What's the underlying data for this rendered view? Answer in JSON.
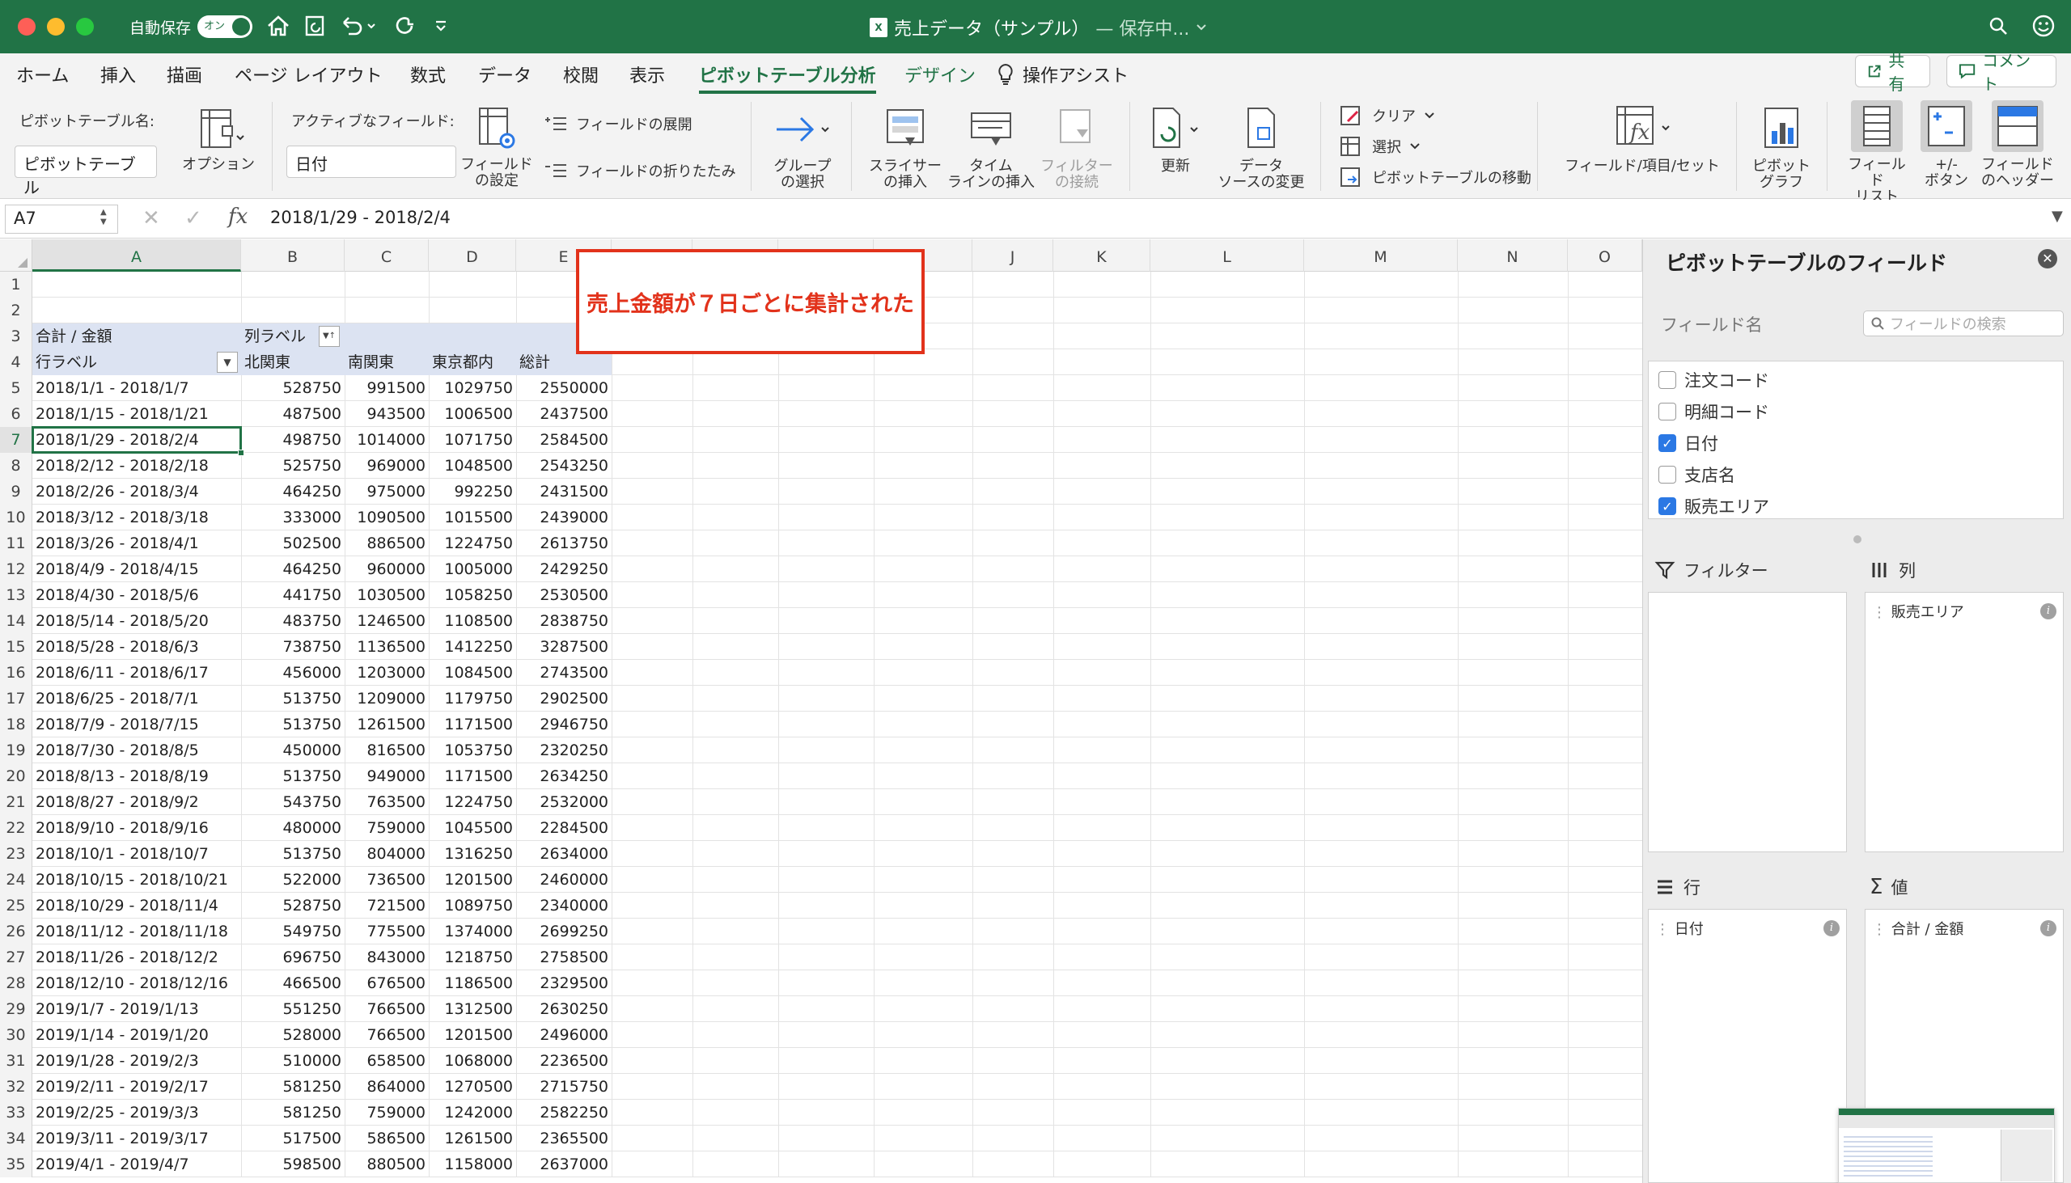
{
  "titlebar": {
    "autosave_label": "自動保存",
    "autosave_state": "オン",
    "doc_title": "売上データ（サンプル）",
    "doc_status": "— 保存中...",
    "app_icon_text": "X"
  },
  "ribbon_tabs": [
    "ホーム",
    "挿入",
    "描画",
    "ページ レイアウト",
    "数式",
    "データ",
    "校閲",
    "表示",
    "ピボットテーブル分析",
    "デザイン",
    "操作アシスト"
  ],
  "share_label": "共有",
  "comment_label": "コメント",
  "ribbon": {
    "pivot_name_label": "ピボットテーブル名:",
    "pivot_name_value": "ピボットテーブル",
    "options_label": "オプション",
    "active_field_label": "アクティブなフィールド:",
    "active_field_value": "日付",
    "field_settings_label_1": "フィールド",
    "field_settings_label_2": "の設定",
    "expand_field_label": "フィールドの展開",
    "collapse_field_label": "フィールドの折りたたみ",
    "group_select_1": "グループ",
    "group_select_2": "の選択",
    "slicer_1": "スライサー",
    "slicer_2": "の挿入",
    "timeline_1": "タイム",
    "timeline_2": "ラインの挿入",
    "filter_conn_1": "フィルター",
    "filter_conn_2": "の接続",
    "refresh_label": "更新",
    "data_source_1": "データ",
    "data_source_2": "ソースの変更",
    "clear_label": "クリア",
    "select_label": "選択",
    "move_pivot_label": "ピボットテーブルの移動",
    "fields_items_label": "フィールド/項目/セット",
    "pivot_chart_1": "ピボット",
    "pivot_chart_2": "グラフ",
    "field_list_1": "フィールド",
    "field_list_2": "リスト",
    "plusminus_1": "+/-",
    "plusminus_2": "ボタン",
    "field_header_1": "フィールド",
    "field_header_2": "のヘッダー"
  },
  "formula_bar": {
    "name_box": "A7",
    "fx": "fx",
    "content": "2018/1/29 - 2018/2/4"
  },
  "columns": [
    "A",
    "B",
    "C",
    "D",
    "E",
    "J",
    "K",
    "L",
    "M",
    "N",
    "O"
  ],
  "pivot": {
    "sum_label": "合計 / 金額",
    "col_label": "列ラベル",
    "row_label": "行ラベル",
    "headers": [
      "北関東",
      "南関東",
      "東京都内",
      "総計"
    ],
    "rows": [
      [
        "2018/1/1 - 2018/1/7",
        "528750",
        "991500",
        "1029750",
        "2550000"
      ],
      [
        "2018/1/15 - 2018/1/21",
        "487500",
        "943500",
        "1006500",
        "2437500"
      ],
      [
        "2018/1/29 - 2018/2/4",
        "498750",
        "1014000",
        "1071750",
        "2584500"
      ],
      [
        "2018/2/12 - 2018/2/18",
        "525750",
        "969000",
        "1048500",
        "2543250"
      ],
      [
        "2018/2/26 - 2018/3/4",
        "464250",
        "975000",
        "992250",
        "2431500"
      ],
      [
        "2018/3/12 - 2018/3/18",
        "333000",
        "1090500",
        "1015500",
        "2439000"
      ],
      [
        "2018/3/26 - 2018/4/1",
        "502500",
        "886500",
        "1224750",
        "2613750"
      ],
      [
        "2018/4/9 - 2018/4/15",
        "464250",
        "960000",
        "1005000",
        "2429250"
      ],
      [
        "2018/4/30 - 2018/5/6",
        "441750",
        "1030500",
        "1058250",
        "2530500"
      ],
      [
        "2018/5/14 - 2018/5/20",
        "483750",
        "1246500",
        "1108500",
        "2838750"
      ],
      [
        "2018/5/28 - 2018/6/3",
        "738750",
        "1136500",
        "1412250",
        "3287500"
      ],
      [
        "2018/6/11 - 2018/6/17",
        "456000",
        "1203000",
        "1084500",
        "2743500"
      ],
      [
        "2018/6/25 - 2018/7/1",
        "513750",
        "1209000",
        "1179750",
        "2902500"
      ],
      [
        "2018/7/9 - 2018/7/15",
        "513750",
        "1261500",
        "1171500",
        "2946750"
      ],
      [
        "2018/7/30 - 2018/8/5",
        "450000",
        "816500",
        "1053750",
        "2320250"
      ],
      [
        "2018/8/13 - 2018/8/19",
        "513750",
        "949000",
        "1171500",
        "2634250"
      ],
      [
        "2018/8/27 - 2018/9/2",
        "543750",
        "763500",
        "1224750",
        "2532000"
      ],
      [
        "2018/9/10 - 2018/9/16",
        "480000",
        "759000",
        "1045500",
        "2284500"
      ],
      [
        "2018/10/1 - 2018/10/7",
        "513750",
        "804000",
        "1316250",
        "2634000"
      ],
      [
        "2018/10/15 - 2018/10/21",
        "522000",
        "736500",
        "1201500",
        "2460000"
      ],
      [
        "2018/10/29 - 2018/11/4",
        "528750",
        "721500",
        "1089750",
        "2340000"
      ],
      [
        "2018/11/12 - 2018/11/18",
        "549750",
        "775500",
        "1374000",
        "2699250"
      ],
      [
        "2018/11/26 - 2018/12/2",
        "696750",
        "843000",
        "1218750",
        "2758500"
      ],
      [
        "2018/12/10 - 2018/12/16",
        "466500",
        "676500",
        "1186500",
        "2329500"
      ],
      [
        "2019/1/7 - 2019/1/13",
        "551250",
        "766500",
        "1312500",
        "2630250"
      ],
      [
        "2019/1/14 - 2019/1/20",
        "528000",
        "766500",
        "1201500",
        "2496000"
      ],
      [
        "2019/1/28 - 2019/2/3",
        "510000",
        "658500",
        "1068000",
        "2236500"
      ],
      [
        "2019/2/11 - 2019/2/17",
        "581250",
        "864000",
        "1270500",
        "2715750"
      ],
      [
        "2019/2/25 - 2019/3/3",
        "581250",
        "759000",
        "1242000",
        "2582250"
      ],
      [
        "2019/3/11 - 2019/3/17",
        "517500",
        "586500",
        "1261500",
        "2365500"
      ],
      [
        "2019/4/1 - 2019/4/7",
        "598500",
        "880500",
        "1158000",
        "2637000"
      ]
    ]
  },
  "callout_text": "売上金額が７日ごとに集計された",
  "pivot_pane": {
    "title": "ピボットテーブルのフィールド",
    "field_name_label": "フィールド名",
    "search_placeholder": "フィールドの検索",
    "fields": [
      {
        "label": "注文コード",
        "checked": false
      },
      {
        "label": "明細コード",
        "checked": false
      },
      {
        "label": "日付",
        "checked": true
      },
      {
        "label": "支店名",
        "checked": false
      },
      {
        "label": "販売エリア",
        "checked": true
      }
    ],
    "filter_title": "フィルター",
    "columns_title": "列",
    "columns_item": "販売エリア",
    "rows_title": "行",
    "rows_item": "日付",
    "values_title": "値",
    "values_item": "合計 / 金額"
  },
  "colors": {
    "accent": "#217346",
    "callout": "#e2321b",
    "checkbox": "#2b78e4",
    "pivot_header": "#dce3f2"
  }
}
